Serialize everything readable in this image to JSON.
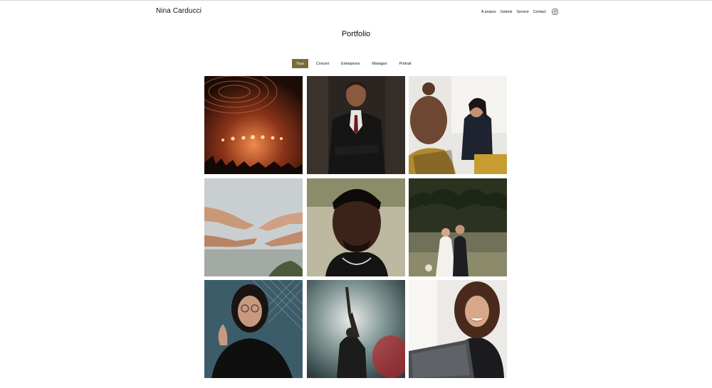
{
  "header": {
    "brand": "Nina Carducci",
    "nav": [
      {
        "label": "À propos"
      },
      {
        "label": "Galerie"
      },
      {
        "label": "Service"
      },
      {
        "label": "Contact"
      }
    ],
    "social_icon": "instagram-icon"
  },
  "main": {
    "title": "Portfolio",
    "filters": [
      {
        "label": "Tous",
        "active": true
      },
      {
        "label": "Concert",
        "active": false
      },
      {
        "label": "Entreprises",
        "active": false
      },
      {
        "label": "Mariages",
        "active": false
      },
      {
        "label": "Portrait",
        "active": false
      }
    ],
    "gallery": [
      {
        "category": "Concert"
      },
      {
        "category": "Entreprises"
      },
      {
        "category": "Entreprises"
      },
      {
        "category": "Mariages"
      },
      {
        "category": "Portrait"
      },
      {
        "category": "Mariages"
      },
      {
        "category": "Portrait"
      },
      {
        "category": "Concert"
      },
      {
        "category": "Entreprises"
      }
    ]
  },
  "colors": {
    "accent": "#7b6b3c",
    "text": "#111111",
    "background": "#ffffff"
  }
}
